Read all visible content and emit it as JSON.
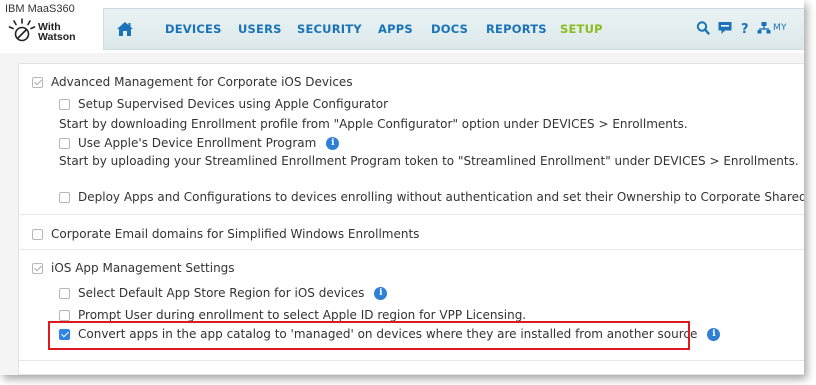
{
  "app": {
    "title": "IBM MaaS360",
    "logo_line1": "With",
    "logo_line2": "Watson"
  },
  "nav": {
    "items": [
      "DEVICES",
      "USERS",
      "SECURITY",
      "APPS",
      "DOCS",
      "REPORTS",
      "SETUP"
    ],
    "active": "SETUP",
    "my_label": "MY"
  },
  "settings": {
    "advanced": {
      "label": "Advanced Management for Corporate iOS Devices",
      "checked": true,
      "supervised_label": "Setup Supervised Devices using Apple Configurator",
      "supervised_checked": false,
      "supervised_help": "Start by downloading Enrollment profile from \"Apple Configurator\" option under DEVICES > Enrollments.",
      "dep_label": "Use Apple's Device Enrollment Program",
      "dep_checked": false,
      "dep_help": "Start by uploading your Streamlined Enrollment Program token to \"Streamlined Enrollment\" under DEVICES > Enrollments.",
      "deploy_label": "Deploy Apps and Configurations to devices enrolling without authentication and set their Ownership to Corporate Shared.",
      "deploy_checked": false
    },
    "corporate_email": {
      "label": "Corporate Email domains for Simplified Windows Enrollments",
      "checked": false
    },
    "ios_app_mgmt": {
      "label": "iOS App Management Settings",
      "checked": true,
      "store_region_label": "Select Default App Store Region for iOS devices",
      "store_region_checked": false,
      "prompt_label": "Prompt User during enrollment to select Apple ID region for VPP Licensing.",
      "prompt_checked": false,
      "convert_label": "Convert apps in the app catalog to 'managed' on devices where they are installed from another source",
      "convert_checked": true
    }
  },
  "colors": {
    "nav_link": "#1a73b8",
    "nav_active": "#8cbc1f",
    "info_icon": "#2f7fd4",
    "checkbox_checked": "#2f84e6",
    "highlight": "#e0191f"
  }
}
